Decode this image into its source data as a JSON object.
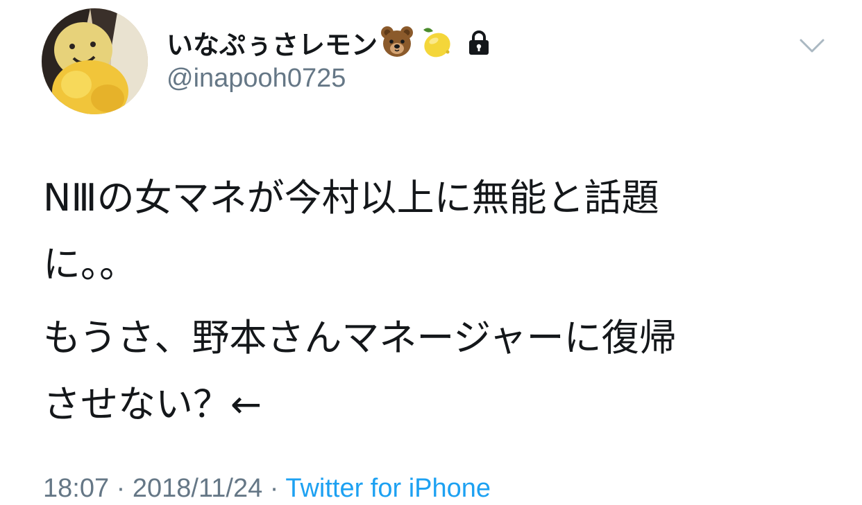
{
  "tweet": {
    "user": {
      "display_name": "いなぷぅさレモン",
      "emojis": [
        "bear-emoji",
        "lemon-emoji"
      ],
      "protected_icon": "lock-icon",
      "handle": "@inapooh0725"
    },
    "menu_icon": "chevron-down-icon",
    "text": {
      "paragraph1": [
        "NⅢの女マネが今村以上に無能と話題",
        "に。。"
      ],
      "paragraph2": [
        "もうさ、野本さんマネージャーに復帰",
        "させない？←"
      ]
    },
    "meta": {
      "time": "18:07",
      "separator": " · ",
      "date": "2018/11/24",
      "source": "Twitter for iPhone"
    },
    "colors": {
      "text": "#14171a",
      "secondary": "#657786",
      "link": "#1da1f2"
    }
  }
}
